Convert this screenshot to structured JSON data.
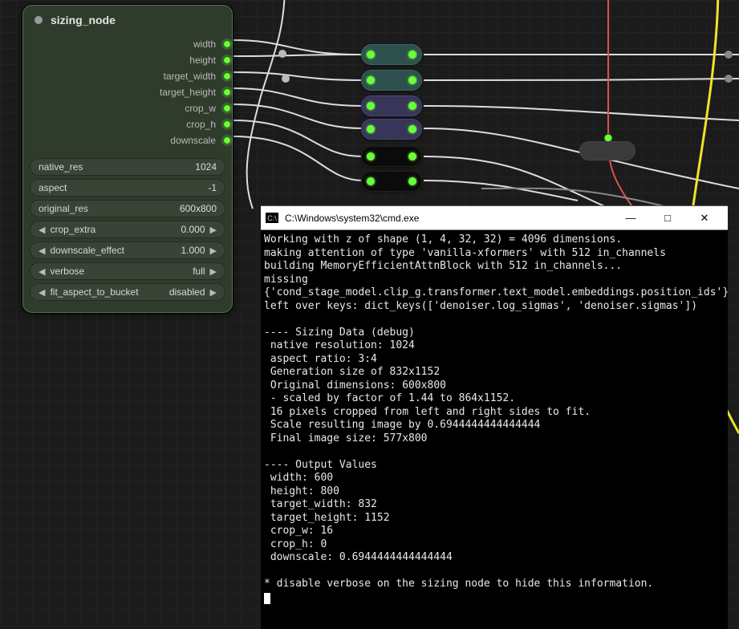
{
  "node": {
    "title": "sizing_node",
    "ports": [
      {
        "label": "width"
      },
      {
        "label": "height"
      },
      {
        "label": "target_width"
      },
      {
        "label": "target_height"
      },
      {
        "label": "crop_w"
      },
      {
        "label": "crop_h"
      },
      {
        "label": "downscale"
      }
    ],
    "props": [
      {
        "name": "native_res",
        "value": "1024",
        "arrows": false
      },
      {
        "name": "aspect",
        "value": "-1",
        "arrows": false
      },
      {
        "name": "original_res",
        "value": "600x800",
        "arrows": false
      },
      {
        "name": "crop_extra",
        "value": "0.000",
        "arrows": true
      },
      {
        "name": "downscale_effect",
        "value": "1.000",
        "arrows": true
      },
      {
        "name": "verbose",
        "value": "full",
        "arrows": true
      },
      {
        "name": "fit_aspect_to_bucket",
        "value": "disabled",
        "arrows": true
      }
    ]
  },
  "cmd": {
    "title": "C:\\Windows\\system32\\cmd.exe",
    "body": "Working with z of shape (1, 4, 32, 32) = 4096 dimensions.\nmaking attention of type 'vanilla-xformers' with 512 in_channels\nbuilding MemoryEfficientAttnBlock with 512 in_channels...\nmissing {'cond_stage_model.clip_g.transformer.text_model.embeddings.position_ids'}\nleft over keys: dict_keys(['denoiser.log_sigmas', 'denoiser.sigmas'])\n\n---- Sizing Data (debug)\n native resolution: 1024\n aspect ratio: 3:4\n Generation size of 832x1152\n Original dimensions: 600x800\n - scaled by factor of 1.44 to 864x1152.\n 16 pixels cropped from left and right sides to fit.\n Scale resulting image by 0.6944444444444444\n Final image size: 577x800\n\n---- Output Values\n width: 600\n height: 800\n target_width: 832\n target_height: 1152\n crop_w: 16\n crop_h: 0\n downscale: 0.6944444444444444\n\n* disable verbose on the sizing node to hide this information.\n"
  },
  "icons": {
    "minimize": "—",
    "maximize": "□",
    "close": "✕",
    "cmdIco": "C:\\"
  }
}
